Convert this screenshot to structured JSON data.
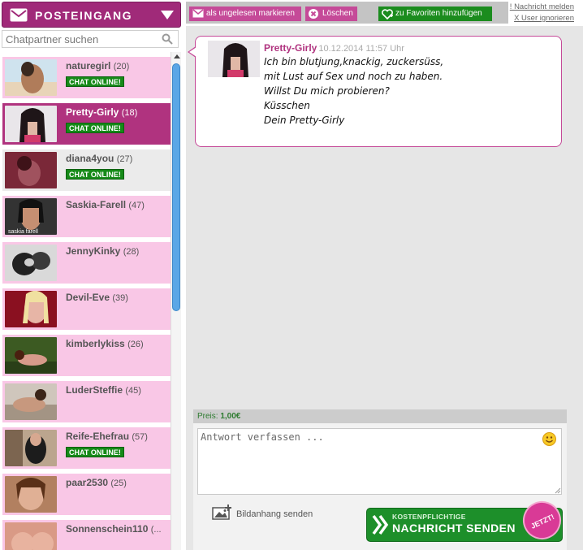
{
  "inbox": {
    "title": "POSTEINGANG"
  },
  "search": {
    "placeholder": "Chatpartner suchen"
  },
  "contacts": [
    {
      "name": "naturegirl",
      "age": "(20)",
      "online": "CHAT ONLINE!"
    },
    {
      "name": "Pretty-Girly",
      "age": "(18)",
      "online": "CHAT ONLINE!"
    },
    {
      "name": "diana4you",
      "age": "(27)",
      "online": "CHAT ONLINE!"
    },
    {
      "name": "Saskia-Farell",
      "age": "(47)",
      "online": "",
      "thumb_caption": "saskia farell"
    },
    {
      "name": "JennyKinky",
      "age": "(28)",
      "online": ""
    },
    {
      "name": "Devil-Eve",
      "age": "(39)",
      "online": ""
    },
    {
      "name": "kimberlykiss",
      "age": "(26)",
      "online": ""
    },
    {
      "name": "LuderSteffie",
      "age": "(45)",
      "online": ""
    },
    {
      "name": "Reife-Ehefrau",
      "age": "(57)",
      "online": "CHAT ONLINE!"
    },
    {
      "name": "paar2530",
      "age": "(25)",
      "online": ""
    },
    {
      "name": "Sonnenschein110",
      "age": "(...",
      "online": ""
    }
  ],
  "toolbar": {
    "mark_unread": "als ungelesen markieren",
    "delete": "Löschen",
    "add_favorite": "zu Favoriten hinzufügen",
    "report": "! Nachricht melden",
    "ignore": "X User ignorieren"
  },
  "message": {
    "sender": "Pretty-Girly",
    "timestamp": "10.12.2014 11:57 Uhr",
    "lines": [
      "Ich bin blutjung,knackig, zuckersüss,",
      "mit Lust auf Sex und noch zu haben.",
      "Willst Du mich probieren?",
      "Küsschen",
      "Dein Pretty-Girly"
    ]
  },
  "composer": {
    "price_label": "Preis:",
    "price_value": "1,00€",
    "placeholder": "Antwort verfassen ...",
    "attach_label": "Bildanhang senden",
    "send_small": "KOSTENPFLICHTIGE",
    "send_big": "NACHRICHT SENDEN",
    "jetzt": "JETZT!"
  },
  "colors": {
    "brand": "#a02a79",
    "contact_bg": "#f9c7e6",
    "active_contact": "#b0337f",
    "online_badge": "#168a18",
    "send_button": "#1d8f2a"
  }
}
